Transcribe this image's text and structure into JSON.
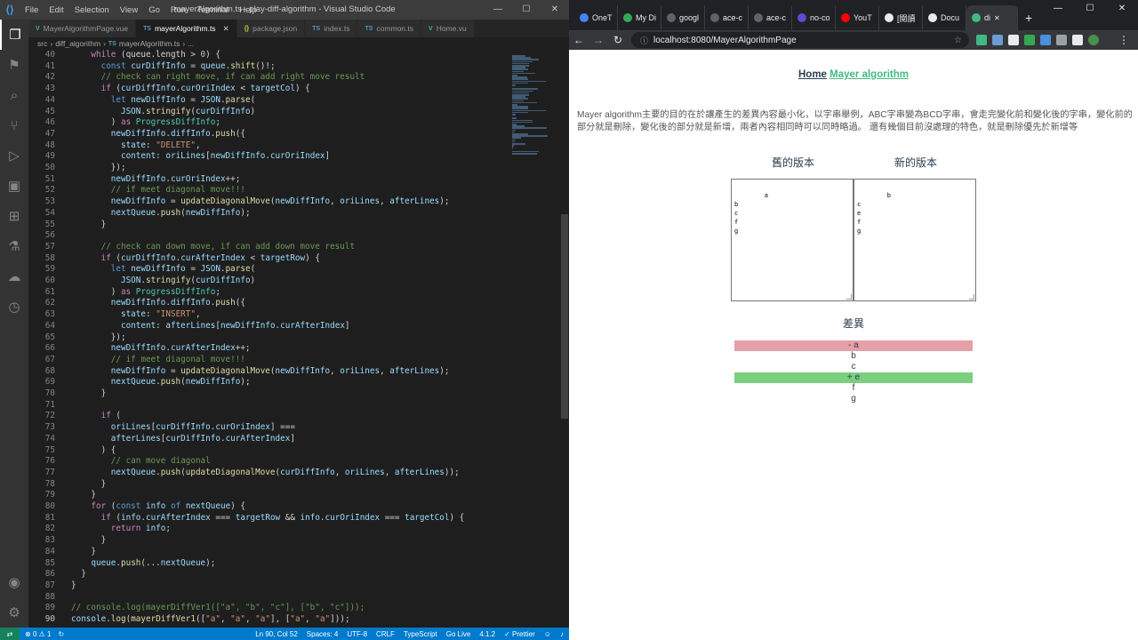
{
  "vscode": {
    "menu": [
      "File",
      "Edit",
      "Selection",
      "View",
      "Go",
      "Run",
      "Terminal",
      "Help"
    ],
    "window_title": "mayerAlgorithm.ts - play-diff-algorithm - Visual Studio Code",
    "tabs": [
      {
        "icon": "V",
        "label": "MayerAlgorithmPage.vue",
        "type": "vue"
      },
      {
        "icon": "TS",
        "label": "mayerAlgorithm.ts",
        "type": "ts",
        "active": true
      },
      {
        "icon": "{}",
        "label": "package.json",
        "type": "json"
      },
      {
        "icon": "TS",
        "label": "index.ts",
        "type": "ts"
      },
      {
        "icon": "TS",
        "label": "common.ts",
        "type": "ts"
      },
      {
        "icon": "V",
        "label": "Home.vu",
        "type": "vue"
      }
    ],
    "breadcrumb": [
      "src",
      "diff_algorithm",
      "TS",
      "mayerAlgorithm.ts",
      "..."
    ],
    "status": {
      "errors": "0",
      "warnings": "1",
      "position": "Ln 90, Col 52",
      "spaces": "Spaces: 4",
      "encoding": "UTF-8",
      "eol": "CRLF",
      "language": "TypeScript",
      "golive": "Go Live",
      "version": "4.1.2",
      "prettier": "✓ Prettier"
    }
  },
  "code_lines": [
    {
      "n": "40",
      "html": "    <span class=\"kc\">while</span> (queue.length > <span class=\"n\">0</span>) {"
    },
    {
      "n": "41",
      "html": "      <span class=\"k\">const</span> <span class=\"v\">curDiffInfo</span> = <span class=\"v\">queue</span>.<span class=\"f\">shift</span>()!;"
    },
    {
      "n": "42",
      "html": "      <span class=\"c\">// check can right move, if can add right move result</span>"
    },
    {
      "n": "43",
      "html": "      <span class=\"kc\">if</span> (<span class=\"v\">curDiffInfo</span>.<span class=\"v\">curOriIndex</span> < <span class=\"v\">targetCol</span>) {"
    },
    {
      "n": "44",
      "html": "        <span class=\"k\">let</span> <span class=\"v\">newDiffInfo</span> = <span class=\"v\">JSON</span>.<span class=\"f\">parse</span>("
    },
    {
      "n": "45",
      "html": "          <span class=\"v\">JSON</span>.<span class=\"f\">stringify</span>(<span class=\"v\">curDiffInfo</span>)"
    },
    {
      "n": "46",
      "html": "        ) <span class=\"kc\">as</span> <span class=\"t\">ProgressDiffInfo</span>;"
    },
    {
      "n": "47",
      "html": "        <span class=\"v\">newDiffInfo</span>.<span class=\"v\">diffInfo</span>.<span class=\"f\">push</span>({"
    },
    {
      "n": "48",
      "html": "          <span class=\"v\">state</span>: <span class=\"s\">\"DELETE\"</span>,"
    },
    {
      "n": "49",
      "html": "          <span class=\"v\">content</span>: <span class=\"v\">oriLines</span>[<span class=\"v\">newDiffInfo</span>.<span class=\"v\">curOriIndex</span>]"
    },
    {
      "n": "50",
      "html": "        });"
    },
    {
      "n": "51",
      "html": "        <span class=\"v\">newDiffInfo</span>.<span class=\"v\">curOriIndex</span>++;"
    },
    {
      "n": "52",
      "html": "        <span class=\"c\">// if meet diagonal move!!!</span>"
    },
    {
      "n": "53",
      "html": "        <span class=\"v\">newDiffInfo</span> = <span class=\"f\">updateDiagonalMove</span>(<span class=\"v\">newDiffInfo</span>, <span class=\"v\">oriLines</span>, <span class=\"v\">afterLines</span>);"
    },
    {
      "n": "54",
      "html": "        <span class=\"v\">nextQueue</span>.<span class=\"f\">push</span>(<span class=\"v\">newDiffInfo</span>);"
    },
    {
      "n": "55",
      "html": "      }"
    },
    {
      "n": "56",
      "html": ""
    },
    {
      "n": "57",
      "html": "      <span class=\"c\">// check can down move, if can add down move result</span>"
    },
    {
      "n": "58",
      "html": "      <span class=\"kc\">if</span> (<span class=\"v\">curDiffInfo</span>.<span class=\"v\">curAfterIndex</span> < <span class=\"v\">targetRow</span>) {"
    },
    {
      "n": "59",
      "html": "        <span class=\"k\">let</span> <span class=\"v\">newDiffInfo</span> = <span class=\"v\">JSON</span>.<span class=\"f\">parse</span>("
    },
    {
      "n": "60",
      "html": "          <span class=\"v\">JSON</span>.<span class=\"f\">stringify</span>(<span class=\"v\">curDiffInfo</span>)"
    },
    {
      "n": "61",
      "html": "        ) <span class=\"kc\">as</span> <span class=\"t\">ProgressDiffInfo</span>;"
    },
    {
      "n": "62",
      "html": "        <span class=\"v\">newDiffInfo</span>.<span class=\"v\">diffInfo</span>.<span class=\"f\">push</span>({"
    },
    {
      "n": "63",
      "html": "          <span class=\"v\">state</span>: <span class=\"s\">\"INSERT\"</span>,"
    },
    {
      "n": "64",
      "html": "          <span class=\"v\">content</span>: <span class=\"v\">afterLines</span>[<span class=\"v\">newDiffInfo</span>.<span class=\"v\">curAfterIndex</span>]"
    },
    {
      "n": "65",
      "html": "        });"
    },
    {
      "n": "66",
      "html": "        <span class=\"v\">newDiffInfo</span>.<span class=\"v\">curAfterIndex</span>++;"
    },
    {
      "n": "67",
      "html": "        <span class=\"c\">// if meet diagonal move!!!</span>"
    },
    {
      "n": "68",
      "html": "        <span class=\"v\">newDiffInfo</span> = <span class=\"f\">updateDiagonalMove</span>(<span class=\"v\">newDiffInfo</span>, <span class=\"v\">oriLines</span>, <span class=\"v\">afterLines</span>);"
    },
    {
      "n": "69",
      "html": "        <span class=\"v\">nextQueue</span>.<span class=\"f\">push</span>(<span class=\"v\">newDiffInfo</span>);"
    },
    {
      "n": "70",
      "html": "      }"
    },
    {
      "n": "71",
      "html": ""
    },
    {
      "n": "72",
      "html": "      <span class=\"kc\">if</span> ("
    },
    {
      "n": "73",
      "html": "        <span class=\"v\">oriLines</span>[<span class=\"v\">curDiffInfo</span>.<span class=\"v\">curOriIndex</span>] ==="
    },
    {
      "n": "74",
      "html": "        <span class=\"v\">afterLines</span>[<span class=\"v\">curDiffInfo</span>.<span class=\"v\">curAfterIndex</span>]"
    },
    {
      "n": "75",
      "html": "      ) {"
    },
    {
      "n": "76",
      "html": "        <span class=\"c\">// can move diagonal</span>"
    },
    {
      "n": "77",
      "html": "        <span class=\"v\">nextQueue</span>.<span class=\"f\">push</span>(<span class=\"f\">updateDiagonalMove</span>(<span class=\"v\">curDiffInfo</span>, <span class=\"v\">oriLines</span>, <span class=\"v\">afterLines</span>));"
    },
    {
      "n": "78",
      "html": "      }"
    },
    {
      "n": "79",
      "html": "    }"
    },
    {
      "n": "80",
      "html": "    <span class=\"kc\">for</span> (<span class=\"k\">const</span> <span class=\"v\">info</span> <span class=\"k\">of</span> <span class=\"v\">nextQueue</span>) {"
    },
    {
      "n": "81",
      "html": "      <span class=\"kc\">if</span> (<span class=\"v\">info</span>.<span class=\"v\">curAfterIndex</span> === <span class=\"v\">targetRow</span> && <span class=\"v\">info</span>.<span class=\"v\">curOriIndex</span> === <span class=\"v\">targetCol</span>) {"
    },
    {
      "n": "82",
      "html": "        <span class=\"kc\">return</span> <span class=\"v\">info</span>;"
    },
    {
      "n": "83",
      "html": "      }"
    },
    {
      "n": "84",
      "html": "    }"
    },
    {
      "n": "85",
      "html": "    <span class=\"v\">queue</span>.<span class=\"f\">push</span>(...<span class=\"v\">nextQueue</span>);"
    },
    {
      "n": "86",
      "html": "  }"
    },
    {
      "n": "87",
      "html": "}"
    },
    {
      "n": "88",
      "html": ""
    },
    {
      "n": "89",
      "html": "<span class=\"c\">// console.log(mayerDiffVer1([\"a\", \"b\", \"c\"], [\"b\", \"c\"]));</span>"
    },
    {
      "n": "90",
      "html": "<span class=\"v\">console</span>.<span class=\"f\">log</span>(<span class=\"f\">mayerDiffVer1</span>([<span class=\"s\">\"a\"</span>, <span class=\"s\">\"a\"</span>, <span class=\"s\">\"a\"</span>], [<span class=\"s\">\"a\"</span>, <span class=\"s\">\"a\"</span>]));",
      "current": true
    }
  ],
  "chrome": {
    "tabs": [
      {
        "label": "OneT",
        "color": "#4285f4"
      },
      {
        "label": "My Di",
        "color": "#34a853"
      },
      {
        "label": "googl",
        "color": "#5f6368"
      },
      {
        "label": "ace-c",
        "color": "#5f6368"
      },
      {
        "label": "ace-c",
        "color": "#5f6368"
      },
      {
        "label": "no-co",
        "color": "#5b4ccf"
      },
      {
        "label": "YouT",
        "color": "#ff0000"
      },
      {
        "label": "[閱讀",
        "color": "#e8eaed"
      },
      {
        "label": "Docu",
        "color": "#e8eaed"
      },
      {
        "label": "di",
        "color": "#42b983",
        "active": true
      }
    ],
    "url": "localhost:8080/MayerAlgorithmPage"
  },
  "page": {
    "nav_home": "Home",
    "nav_active": "Mayer algorithm",
    "description": "Mayer algorithm主要的目的在於讓產生的差異內容最小化，以字串舉例，ABC字串變為BCD字串，會走完變化前和變化後的字串，變化前的部分就是刪除，變化後的部分就是新增，兩者內容相同時可以同時略過。 還有幾個目前沒處理的特色，就是刪除優先於新增等",
    "old_title": "舊的版本",
    "new_title": "新的版本",
    "old_text": "a\nb\nc\nf\ng",
    "new_text": "b\nc\ne\nf\ng",
    "diff_title": "差異",
    "diff": [
      {
        "text": "- a",
        "state": "del"
      },
      {
        "text": "b",
        "state": "same"
      },
      {
        "text": "c",
        "state": "same"
      },
      {
        "text": "+ e",
        "state": "ins"
      },
      {
        "text": "f",
        "state": "same"
      },
      {
        "text": "g",
        "state": "same"
      }
    ]
  }
}
